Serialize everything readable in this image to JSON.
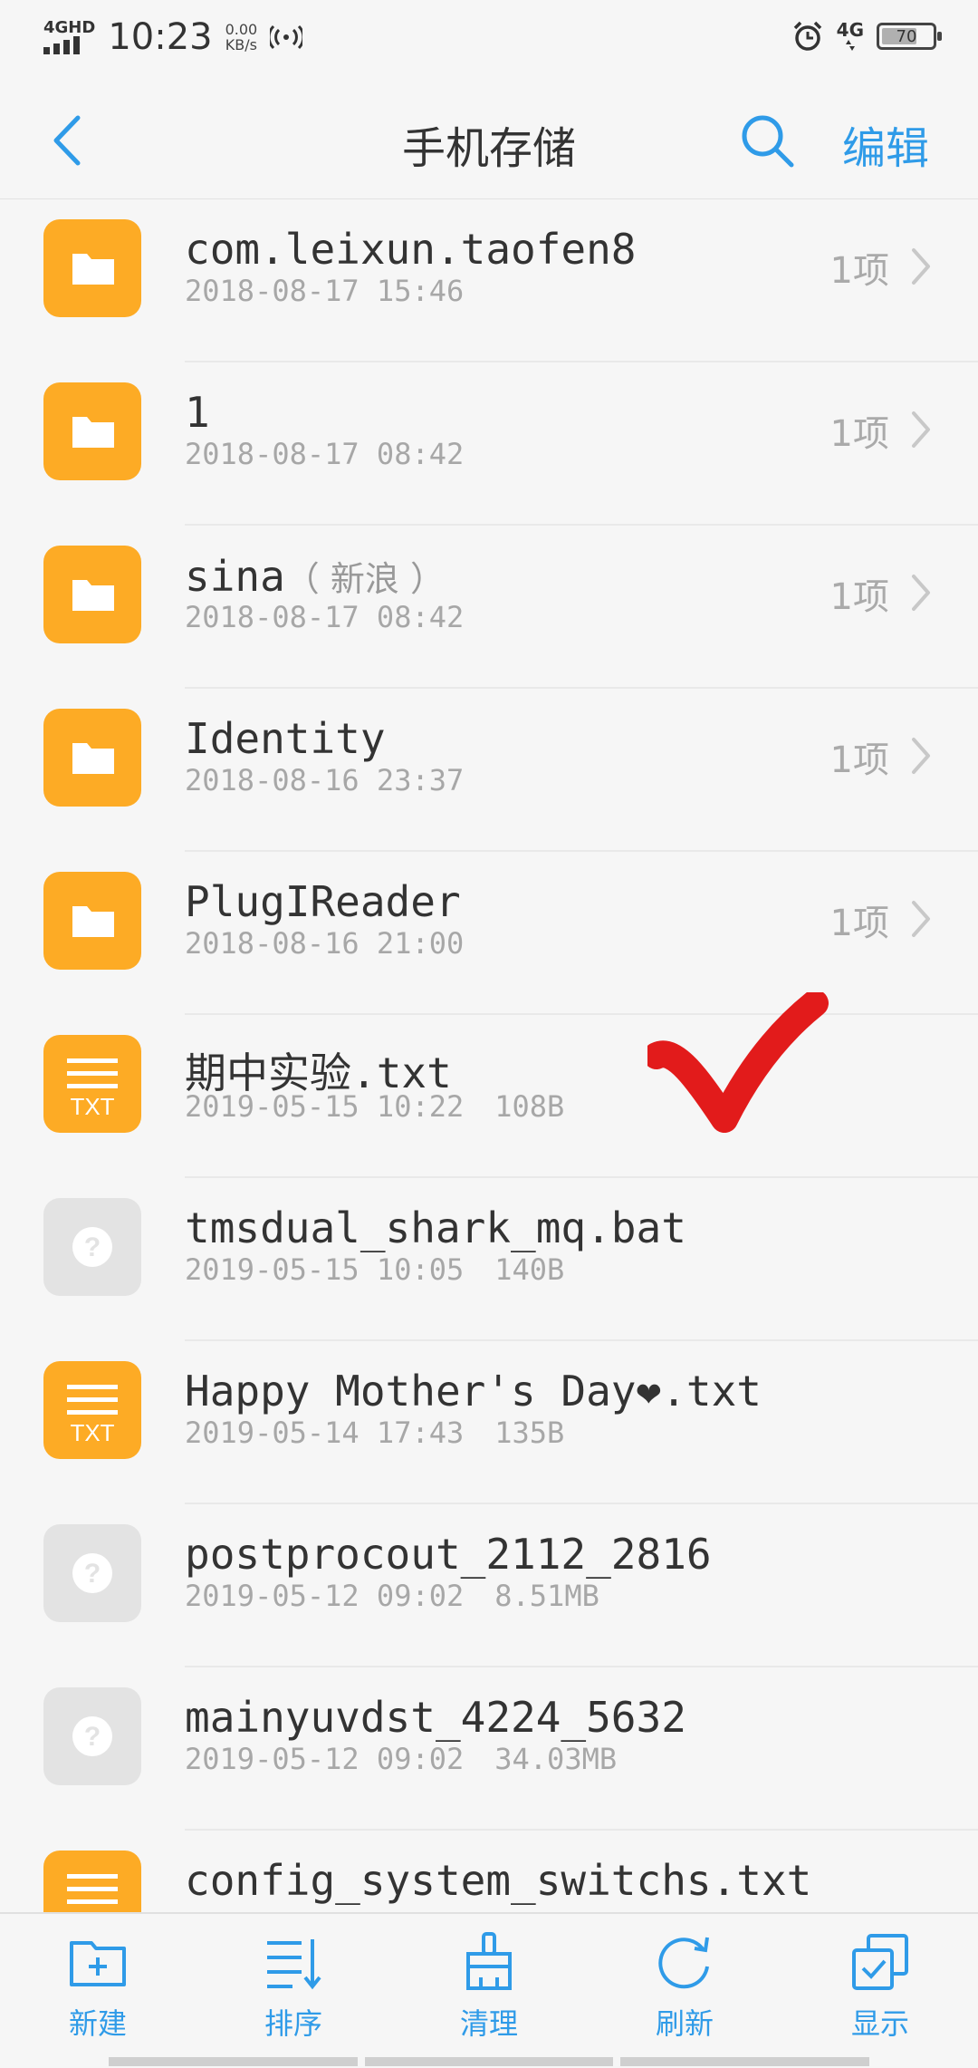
{
  "status_bar": {
    "network": "4GHD",
    "time": "10:23",
    "speed_value": "0.00",
    "speed_unit": "KB/s",
    "signal2": "4G",
    "battery": "70",
    "battery_level": 0.7
  },
  "header": {
    "title": "手机存储",
    "edit_label": "编辑"
  },
  "files": [
    {
      "type": "folder",
      "name": "com.leixun.taofen8",
      "sub": "",
      "date": "2018-08-17 15:46",
      "size": "",
      "count": "1项"
    },
    {
      "type": "folder",
      "name": "1",
      "sub": "",
      "date": "2018-08-17 08:42",
      "size": "",
      "count": "1项"
    },
    {
      "type": "folder",
      "name": "sina",
      "sub": "（ 新浪 ）",
      "date": "2018-08-17 08:42",
      "size": "",
      "count": "1项"
    },
    {
      "type": "folder",
      "name": "Identity",
      "sub": "",
      "date": "2018-08-16 23:37",
      "size": "",
      "count": "1项"
    },
    {
      "type": "folder",
      "name": "PlugIReader",
      "sub": "",
      "date": "2018-08-16 21:00",
      "size": "",
      "count": "1项"
    },
    {
      "type": "txt",
      "name": "期中实验.txt",
      "sub": "",
      "date": "2019-05-15 10:22",
      "size": "108B",
      "count": ""
    },
    {
      "type": "unknown",
      "name": "tmsdual_shark_mq.bat",
      "sub": "",
      "date": "2019-05-15 10:05",
      "size": "140B",
      "count": ""
    },
    {
      "type": "txt",
      "name": "Happy Mother's Day❤.txt",
      "sub": "",
      "date": "2019-05-14 17:43",
      "size": "135B",
      "count": ""
    },
    {
      "type": "unknown",
      "name": "postprocout_2112_2816",
      "sub": "",
      "date": "2019-05-12 09:02",
      "size": "8.51MB",
      "count": ""
    },
    {
      "type": "unknown",
      "name": "mainyuvdst_4224_5632",
      "sub": "",
      "date": "2019-05-12 09:02",
      "size": "34.03MB",
      "count": ""
    },
    {
      "type": "txt",
      "name": "config_system_switchs.txt",
      "sub": "",
      "date": "",
      "size": "",
      "count": ""
    }
  ],
  "txt_icon_label": "TXT",
  "toolbar": {
    "new": "新建",
    "sort": "排序",
    "clean": "清理",
    "refresh": "刷新",
    "display": "显示"
  },
  "colors": {
    "accent": "#2f9be8",
    "folder": "#fdab25",
    "checkmark": "#e21b1b"
  }
}
